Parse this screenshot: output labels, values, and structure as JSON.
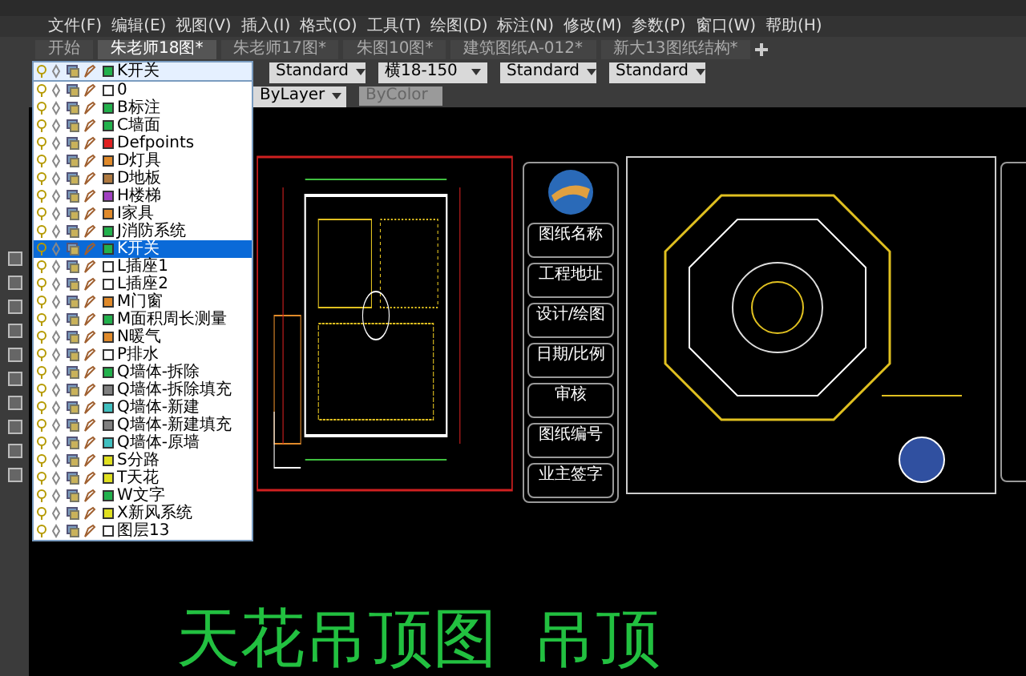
{
  "menu": [
    "文件(F)",
    "编辑(E)",
    "视图(V)",
    "插入(I)",
    "格式(O)",
    "工具(T)",
    "绘图(D)",
    "标注(N)",
    "修改(M)",
    "参数(P)",
    "窗口(W)",
    "帮助(H)"
  ],
  "tabs": [
    {
      "label": "开始",
      "selected": false
    },
    {
      "label": "朱老师18图*",
      "selected": true
    },
    {
      "label": "朱老师17图*",
      "selected": false
    },
    {
      "label": "朱图10图*",
      "selected": false
    },
    {
      "label": "建筑图纸A-012*",
      "selected": false
    },
    {
      "label": "新大13图纸结构*",
      "selected": false
    }
  ],
  "toolbar": {
    "current_layer": "K开关",
    "text_style": "Standard",
    "dim_style": "横18-150",
    "table_style": "Standard",
    "multileader_style": "Standard"
  },
  "properties": {
    "linetype": "ByLayer",
    "plot_color": "ByColor"
  },
  "layers": [
    {
      "name": "0",
      "color": "#ffffff",
      "selected": false
    },
    {
      "name": "B标注",
      "color": "#22b14c",
      "selected": false
    },
    {
      "name": "C墙面",
      "color": "#22b14c",
      "selected": false
    },
    {
      "name": "Defpoints",
      "color": "#e02020",
      "selected": false
    },
    {
      "name": "D灯具",
      "color": "#e08a2a",
      "selected": false
    },
    {
      "name": "D地板",
      "color": "#b07a40",
      "selected": false
    },
    {
      "name": "H楼梯",
      "color": "#a040c0",
      "selected": false
    },
    {
      "name": "I家具",
      "color": "#e08a2a",
      "selected": false
    },
    {
      "name": "J消防系统",
      "color": "#22b14c",
      "selected": false
    },
    {
      "name": "K开关",
      "color": "#22b14c",
      "selected": true
    },
    {
      "name": "L插座1",
      "color": "#ffffff",
      "selected": false
    },
    {
      "name": "L插座2",
      "color": "#ffffff",
      "selected": false
    },
    {
      "name": "M门窗",
      "color": "#e08a2a",
      "selected": false
    },
    {
      "name": "M面积周长测量",
      "color": "#22b14c",
      "selected": false
    },
    {
      "name": "N暖气",
      "color": "#e08a2a",
      "selected": false
    },
    {
      "name": "P排水",
      "color": "#ffffff",
      "selected": false
    },
    {
      "name": "Q墙体-拆除",
      "color": "#22b14c",
      "selected": false
    },
    {
      "name": "Q墙体-拆除填充",
      "color": "#808080",
      "selected": false
    },
    {
      "name": "Q墙体-新建",
      "color": "#40c0c0",
      "selected": false
    },
    {
      "name": "Q墙体-新建填充",
      "color": "#808080",
      "selected": false
    },
    {
      "name": "Q墙体-原墙",
      "color": "#40c0c0",
      "selected": false
    },
    {
      "name": "S分路",
      "color": "#e0e020",
      "selected": false
    },
    {
      "name": "T天花",
      "color": "#e0e020",
      "selected": false
    },
    {
      "name": "W文字",
      "color": "#22b14c",
      "selected": false
    },
    {
      "name": "X新风系统",
      "color": "#e0e020",
      "selected": false
    },
    {
      "name": "图层13",
      "color": "#ffffff",
      "selected": false
    }
  ],
  "title_block": [
    "图纸名称",
    "工程地址",
    "设计/绘图",
    "日期/比例",
    "审核",
    "图纸编号",
    "业主签字"
  ],
  "headings": [
    "天花吊顶图",
    "吊顶"
  ]
}
